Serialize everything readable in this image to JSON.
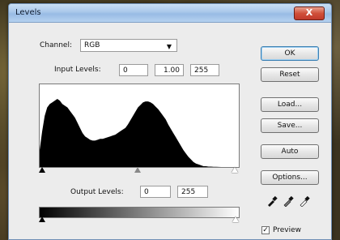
{
  "window": {
    "title": "Levels",
    "close_symbol": "X"
  },
  "channel": {
    "label": "Channel:",
    "value": "RGB"
  },
  "input_levels": {
    "label": "Input Levels:",
    "black": "0",
    "gamma": "1.00",
    "white": "255"
  },
  "output_levels": {
    "label": "Output Levels:",
    "black": "0",
    "white": "255"
  },
  "buttons": {
    "ok": "OK",
    "reset": "Reset",
    "load": "Load...",
    "save": "Save...",
    "auto": "Auto",
    "options": "Options..."
  },
  "preview": {
    "label": "Preview",
    "checked": true,
    "check_glyph": "✓"
  },
  "colors": {
    "title_bar": "#a9c7ea",
    "close": "#c0392b",
    "default_button_border": "#3c7fb1"
  },
  "histogram": {
    "values": [
      20,
      42,
      60,
      70,
      74,
      76,
      78,
      80,
      78,
      74,
      72,
      70,
      66,
      62,
      58,
      52,
      46,
      40,
      36,
      34,
      32,
      31,
      31,
      32,
      33,
      33,
      34,
      35,
      36,
      37,
      38,
      40,
      42,
      44,
      46,
      50,
      55,
      60,
      65,
      70,
      73,
      76,
      77,
      77,
      76,
      74,
      71,
      68,
      64,
      60,
      56,
      50,
      45,
      40,
      35,
      30,
      25,
      20,
      16,
      12,
      9,
      6,
      4,
      3,
      2,
      1,
      1,
      0.5,
      0.5,
      0.3,
      0.2,
      0.1,
      0,
      0,
      0,
      0,
      0,
      0,
      0,
      0
    ]
  }
}
